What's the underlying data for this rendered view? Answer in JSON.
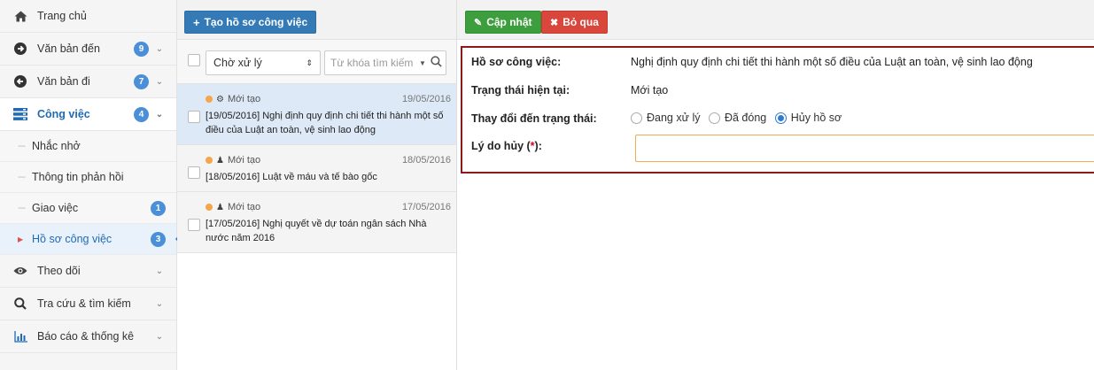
{
  "sidebar": {
    "items": [
      {
        "name": "home",
        "label": "Trang chủ",
        "icon": "home-icon",
        "badge": null,
        "chevron": false
      },
      {
        "name": "incoming-docs",
        "label": "Văn bản đến",
        "icon": "arrow-circle-right-icon",
        "badge": "9",
        "chevron": true
      },
      {
        "name": "outgoing-docs",
        "label": "Văn bản đi",
        "icon": "arrow-circle-left-icon",
        "badge": "7",
        "chevron": true
      },
      {
        "name": "tasks",
        "label": "Công việc",
        "icon": "server-stack-icon",
        "badge": "4",
        "chevron": true,
        "active": true
      }
    ],
    "subitems": [
      {
        "name": "reminders",
        "label": "Nhắc nhở",
        "badge": null
      },
      {
        "name": "feedback",
        "label": "Thông tin phản hồi",
        "badge": null
      },
      {
        "name": "assign-task",
        "label": "Giao việc",
        "badge": "1"
      },
      {
        "name": "work-dossier",
        "label": "Hồ sơ công việc",
        "badge": "3",
        "active": true
      }
    ],
    "bottom_items": [
      {
        "name": "follow",
        "label": "Theo dõi",
        "icon": "eye-icon"
      },
      {
        "name": "lookup",
        "label": "Tra cứu & tìm kiếm",
        "icon": "search-icon"
      },
      {
        "name": "reports",
        "label": "Báo cáo & thống kê",
        "icon": "bar-chart-icon"
      }
    ]
  },
  "middle": {
    "create_button": "Tạo hồ sơ công việc",
    "status_filter": "Chờ xử lý",
    "search_placeholder": "Từ khóa tìm kiếm",
    "items": [
      {
        "status": "Mới tạo",
        "kind_icon": "gear-icon",
        "date": "19/05/2016",
        "title": "[19/05/2016] Nghị định quy định chi tiết thi hành một số điều của Luật an toàn, vệ sinh lao động",
        "selected": true
      },
      {
        "status": "Mới tạo",
        "kind_icon": "users-icon",
        "date": "18/05/2016",
        "title": "[18/05/2016] Luật về máu và tế bào gốc",
        "selected": false
      },
      {
        "status": "Mới tạo",
        "kind_icon": "users-icon",
        "date": "17/05/2016",
        "title": "[17/05/2016] Nghị quyết về dự toán ngân sách Nhà nước năm 2016",
        "selected": false
      }
    ]
  },
  "detail": {
    "update_button": "Cập nhật",
    "skip_button": "Bỏ qua",
    "dossier_label": "Hồ sơ công việc:",
    "dossier_value": "Nghị định quy định chi tiết thi hành một số điều của Luật an toàn, vệ sinh lao động",
    "current_status_label": "Trạng thái hiện tại:",
    "current_status_value": "Mới tạo",
    "change_status_label": "Thay đổi đến trạng thái:",
    "status_options": [
      "Đang xử lý",
      "Đã đóng",
      "Hủy hồ sơ"
    ],
    "selected_status": "Hủy hồ sơ",
    "reason_label": "Lý do hủy (",
    "reason_required": "*",
    "reason_label_end": "):",
    "reason_value": ""
  },
  "colors": {
    "primary": "#337ab7",
    "success": "#3d9e3d",
    "danger": "#d9463c",
    "badge": "#4a8fd8",
    "form_border": "#8b1a1a"
  }
}
